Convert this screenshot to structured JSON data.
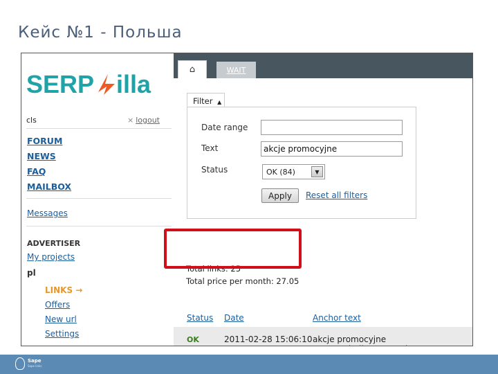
{
  "slide": {
    "title": "Кейс №1 - Польша"
  },
  "sidebar": {
    "logo": {
      "left": "SERP",
      "right": "illa"
    },
    "user": "cls",
    "logout_label": "logout",
    "nav": [
      {
        "label": "FORUM"
      },
      {
        "label": "NEWS"
      },
      {
        "label": "FAQ"
      },
      {
        "label": "MAILBOX"
      }
    ],
    "messages_label": "Messages",
    "section_title": "ADVERTISER",
    "my_projects_label": "My projects",
    "project_name": "pl",
    "project_links": [
      {
        "label": "LINKS →",
        "active": true
      },
      {
        "label": "Offers"
      },
      {
        "label": "New url"
      },
      {
        "label": "Settings"
      }
    ]
  },
  "tabs": {
    "wait_label": "WAIT"
  },
  "filter": {
    "tab_label": "Filter",
    "date_range_label": "Date range",
    "date_range_value": "",
    "text_label": "Text",
    "text_value": "akcje promocyjne",
    "status_label": "Status",
    "status_value": "OK (84)",
    "apply_label": "Apply",
    "reset_label": "Reset all filters"
  },
  "totals": {
    "total_links": "Total links: 25",
    "total_price": "Total price per month: 27.05"
  },
  "table": {
    "headers": [
      "Status",
      "Date",
      "Anchor text"
    ],
    "rows": [
      {
        "status": "OK",
        "date": "2011-02-28 15:06:10",
        "anchor": "akcje promocyjne www.preludium.com.pl"
      }
    ]
  },
  "footer": {
    "brand": "Sape",
    "tagline": "Sape links"
  },
  "colors": {
    "link": "#1b5e9e",
    "active_link": "#e8962a",
    "logo_teal": "#1fa3a8",
    "logo_orange": "#ef5a24",
    "highlight_red": "#d10f1a",
    "tabbar": "#47565f",
    "footer_bar": "#5b8ab5",
    "status_ok": "#3a7d1e"
  }
}
